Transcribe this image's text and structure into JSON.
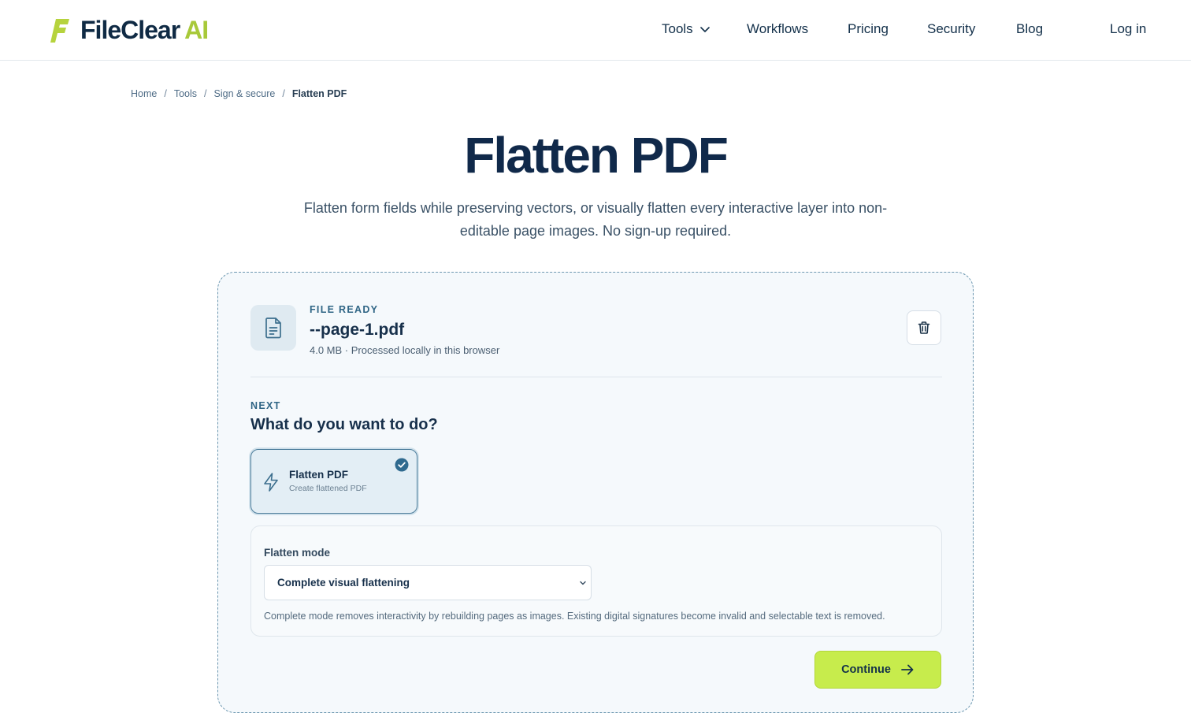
{
  "header": {
    "logo_text": "FileClear",
    "logo_ai": "AI",
    "nav": {
      "tools": "Tools",
      "workflows": "Workflows",
      "pricing": "Pricing",
      "security": "Security",
      "blog": "Blog",
      "login": "Log in"
    }
  },
  "breadcrumb": {
    "items": [
      "Home",
      "Tools",
      "Sign & secure"
    ],
    "current": "Flatten PDF",
    "separator": "/"
  },
  "hero": {
    "title": "Flatten PDF",
    "subtitle": "Flatten form fields while preserving vectors, or visually flatten every interactive layer into non-editable page images. No sign-up required."
  },
  "file": {
    "status": "FILE READY",
    "name": "--page-1.pdf",
    "meta": "4.0 MB · Processed locally in this browser"
  },
  "next": {
    "label": "NEXT",
    "question": "What do you want to do?",
    "option": {
      "title": "Flatten PDF",
      "subtitle": "Create flattened PDF",
      "selected": true
    }
  },
  "settings": {
    "label": "Flatten mode",
    "selected_value": "Complete visual flattening",
    "note": "Complete mode removes interactivity by rebuilding pages as images. Existing digital signatures become invalid and selectable text is removed."
  },
  "actions": {
    "continue_label": "Continue"
  },
  "colors": {
    "brand_dark": "#0f2a44",
    "brand_accent": "#a8c93a",
    "button_bg": "#c7ec4c",
    "label_blue": "#2f6585"
  },
  "icons": {
    "logo": "fileclear-logo-icon",
    "tools_chevron": "chevron-down-icon",
    "file": "document-icon",
    "delete": "trash-icon",
    "option": "lightning-icon",
    "check": "check-circle-icon",
    "select": "chevron-down-icon",
    "arrow": "arrow-right-icon"
  }
}
